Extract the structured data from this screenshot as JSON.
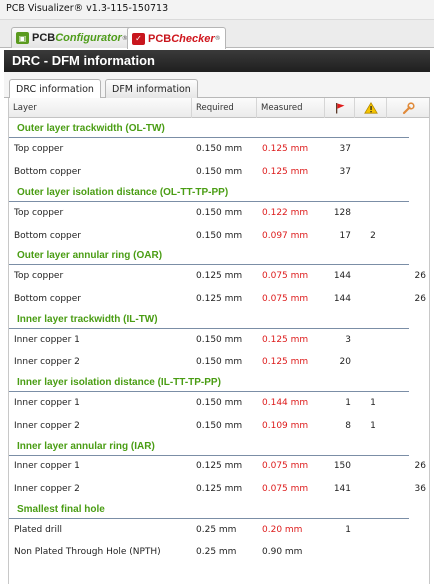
{
  "window": {
    "title": "PCB Visualizer® v1.3-115-150713"
  },
  "app_tabs": [
    {
      "pcb": "PCB",
      "name": "Configurator",
      "reg": "®"
    },
    {
      "pcb": "PCB",
      "name": "Checker",
      "reg": "®"
    }
  ],
  "panel": {
    "title": "DRC - DFM information"
  },
  "sub_tabs": [
    "DRC information",
    "DFM information"
  ],
  "table": {
    "headers": {
      "layer": "Layer",
      "required": "Required",
      "measured": "Measured"
    },
    "header_icons": [
      "red-flag-icon",
      "warning-icon",
      "wrench-icon"
    ],
    "colors": {
      "section": "#4a9d14",
      "measured": "#dd1c1c"
    }
  },
  "sections": [
    {
      "title": "Outer layer trackwidth (OL-TW)",
      "rows": [
        {
          "layer": "Top copper",
          "required": "0.150 mm",
          "measured": "0.125 mm",
          "errors": "37",
          "warnings": "",
          "info": ""
        },
        {
          "layer": "Bottom copper",
          "required": "0.150 mm",
          "measured": "0.125 mm",
          "errors": "37",
          "warnings": "",
          "info": ""
        }
      ]
    },
    {
      "title": "Outer layer isolation distance (OL-TT-TP-PP)",
      "rows": [
        {
          "layer": "Top copper",
          "required": "0.150 mm",
          "measured": "0.122 mm",
          "errors": "128",
          "warnings": "",
          "info": ""
        },
        {
          "layer": "Bottom copper",
          "required": "0.150 mm",
          "measured": "0.097 mm",
          "errors": "17",
          "warnings": "2",
          "info": ""
        }
      ]
    },
    {
      "title": "Outer layer annular ring (OAR)",
      "rows": [
        {
          "layer": "Top copper",
          "required": "0.125 mm",
          "measured": "0.075 mm",
          "errors": "144",
          "warnings": "",
          "info": "26"
        },
        {
          "layer": "Bottom copper",
          "required": "0.125 mm",
          "measured": "0.075 mm",
          "errors": "144",
          "warnings": "",
          "info": "26"
        }
      ]
    },
    {
      "title": "Inner layer trackwidth (IL-TW)",
      "rows": [
        {
          "layer": "Inner copper 1",
          "required": "0.150 mm",
          "measured": "0.125 mm",
          "errors": "3",
          "warnings": "",
          "info": ""
        },
        {
          "layer": "Inner copper 2",
          "required": "0.150 mm",
          "measured": "0.125 mm",
          "errors": "20",
          "warnings": "",
          "info": ""
        }
      ]
    },
    {
      "title": "Inner layer isolation distance (IL-TT-TP-PP)",
      "rows": [
        {
          "layer": "Inner copper 1",
          "required": "0.150 mm",
          "measured": "0.144 mm",
          "errors": "1",
          "warnings": "1",
          "info": ""
        },
        {
          "layer": "Inner copper 2",
          "required": "0.150 mm",
          "measured": "0.109 mm",
          "errors": "8",
          "warnings": "1",
          "info": ""
        }
      ]
    },
    {
      "title": "Inner layer annular ring (IAR)",
      "rows": [
        {
          "layer": "Inner copper 1",
          "required": "0.125 mm",
          "measured": "0.075 mm",
          "errors": "150",
          "warnings": "",
          "info": "26"
        },
        {
          "layer": "Inner copper 2",
          "required": "0.125 mm",
          "measured": "0.075 mm",
          "errors": "141",
          "warnings": "",
          "info": "36"
        }
      ]
    },
    {
      "title": "Smallest final hole",
      "rows": [
        {
          "layer": "Plated drill",
          "required": "0.25 mm",
          "measured": "0.20 mm",
          "errors": "1",
          "warnings": "",
          "info": ""
        },
        {
          "layer": "Non Plated Through Hole (NPTH)",
          "required": "0.25 mm",
          "measured": "0.90 mm",
          "errors": "",
          "warnings": "",
          "info": "",
          "measured_color": "#222222"
        }
      ]
    }
  ]
}
